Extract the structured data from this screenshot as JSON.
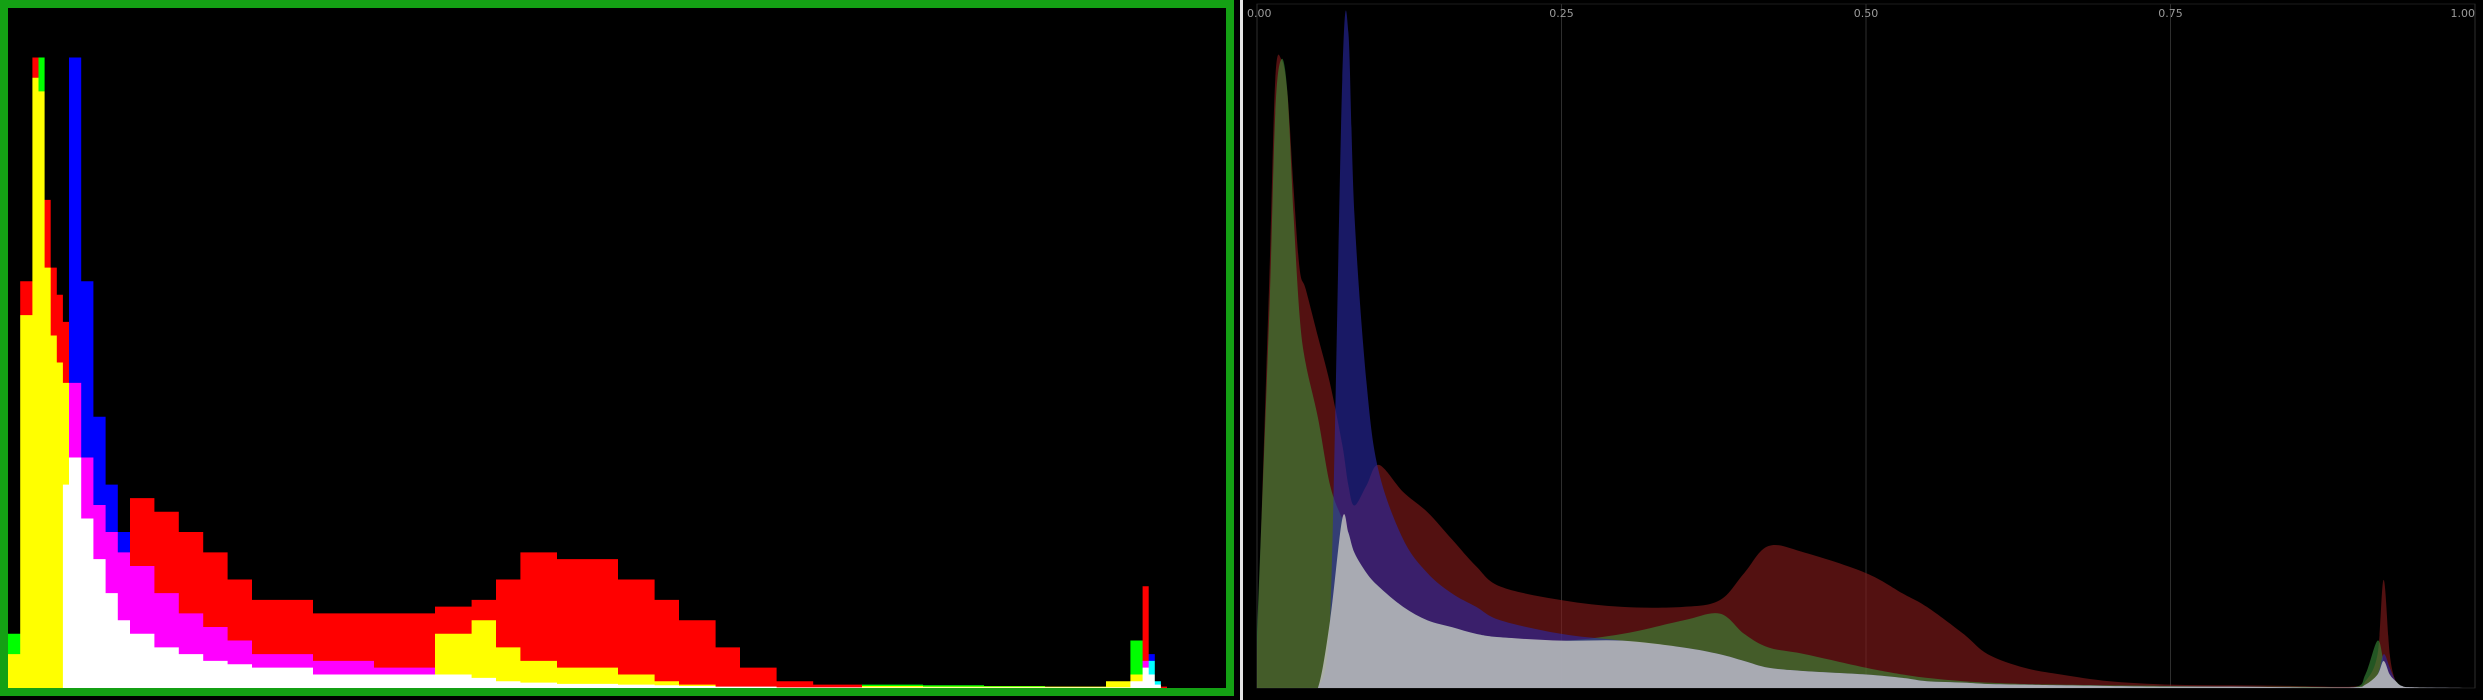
{
  "chart_data": [
    {
      "type": "area",
      "style": "step",
      "blend": "additive-primary",
      "frame_color": "#14a014",
      "x": [
        0.0,
        0.01,
        0.02,
        0.025,
        0.03,
        0.035,
        0.04,
        0.045,
        0.05,
        0.06,
        0.07,
        0.08,
        0.09,
        0.1,
        0.12,
        0.14,
        0.16,
        0.18,
        0.2,
        0.25,
        0.3,
        0.35,
        0.38,
        0.4,
        0.42,
        0.45,
        0.5,
        0.53,
        0.55,
        0.58,
        0.6,
        0.63,
        0.66,
        0.7,
        0.75,
        0.8,
        0.85,
        0.9,
        0.92,
        0.93,
        0.935,
        0.94,
        0.945,
        0.95,
        0.96,
        1.0
      ],
      "series": [
        {
          "color": "#ff0000",
          "values": [
            0.05,
            0.6,
            0.93,
            0.88,
            0.72,
            0.62,
            0.58,
            0.54,
            0.45,
            0.34,
            0.27,
            0.23,
            0.2,
            0.28,
            0.26,
            0.23,
            0.2,
            0.16,
            0.13,
            0.11,
            0.11,
            0.12,
            0.13,
            0.16,
            0.2,
            0.19,
            0.16,
            0.13,
            0.1,
            0.06,
            0.03,
            0.01,
            0.005,
            0.003,
            0.002,
            0.002,
            0.002,
            0.01,
            0.02,
            0.15,
            0.02,
            0.005,
            0.002,
            0.0,
            0.0,
            0.0
          ]
        },
        {
          "color": "#00ff00",
          "values": [
            0.08,
            0.55,
            0.9,
            0.93,
            0.62,
            0.52,
            0.48,
            0.45,
            0.34,
            0.25,
            0.19,
            0.14,
            0.1,
            0.08,
            0.06,
            0.05,
            0.04,
            0.035,
            0.03,
            0.02,
            0.02,
            0.08,
            0.1,
            0.06,
            0.04,
            0.03,
            0.02,
            0.01,
            0.005,
            0.002,
            0.002,
            0.001,
            0.001,
            0.005,
            0.004,
            0.003,
            0.002,
            0.01,
            0.07,
            0.03,
            0.04,
            0.01,
            0.0,
            0.0,
            0.0,
            0.0
          ]
        },
        {
          "color": "#0000ff",
          "values": [
            0.0,
            0.0,
            0.0,
            0.0,
            0.0,
            0.0,
            0.0,
            0.3,
            0.93,
            0.6,
            0.4,
            0.3,
            0.23,
            0.18,
            0.14,
            0.11,
            0.09,
            0.07,
            0.05,
            0.04,
            0.03,
            0.02,
            0.015,
            0.01,
            0.008,
            0.006,
            0.005,
            0.004,
            0.003,
            0.002,
            0.002,
            0.001,
            0.001,
            0.001,
            0.001,
            0.001,
            0.001,
            0.001,
            0.01,
            0.04,
            0.05,
            0.01,
            0.0,
            0.0,
            0.0,
            0.0
          ]
        }
      ]
    },
    {
      "type": "area",
      "style": "smooth",
      "blend": "translucent",
      "xlim": [
        0,
        1
      ],
      "xticks": [
        "0.00",
        "0.25",
        "0.50",
        "0.75",
        "1.00"
      ],
      "grid": true,
      "x": [
        0.0,
        0.01,
        0.015,
        0.02,
        0.025,
        0.03,
        0.035,
        0.04,
        0.05,
        0.06,
        0.07,
        0.075,
        0.08,
        0.09,
        0.1,
        0.12,
        0.14,
        0.16,
        0.18,
        0.2,
        0.25,
        0.3,
        0.35,
        0.38,
        0.4,
        0.42,
        0.45,
        0.5,
        0.53,
        0.55,
        0.58,
        0.6,
        0.63,
        0.66,
        0.7,
        0.75,
        0.8,
        0.85,
        0.9,
        0.91,
        0.92,
        0.925,
        0.93,
        0.935,
        0.94,
        0.95,
        1.0
      ],
      "series": [
        {
          "color": "#8a1c1c",
          "values": [
            0.05,
            0.6,
            0.9,
            0.93,
            0.88,
            0.74,
            0.62,
            0.59,
            0.52,
            0.45,
            0.36,
            0.3,
            0.27,
            0.3,
            0.33,
            0.29,
            0.26,
            0.22,
            0.18,
            0.15,
            0.13,
            0.12,
            0.12,
            0.13,
            0.17,
            0.21,
            0.2,
            0.17,
            0.14,
            0.12,
            0.08,
            0.05,
            0.03,
            0.02,
            0.01,
            0.005,
            0.004,
            0.003,
            0.002,
            0.01,
            0.05,
            0.16,
            0.05,
            0.01,
            0.003,
            0.001,
            0.0
          ]
        },
        {
          "color": "#3a8f3a",
          "values": [
            0.08,
            0.55,
            0.85,
            0.93,
            0.88,
            0.7,
            0.55,
            0.48,
            0.4,
            0.3,
            0.25,
            0.23,
            0.2,
            0.17,
            0.15,
            0.12,
            0.1,
            0.09,
            0.08,
            0.075,
            0.07,
            0.08,
            0.1,
            0.11,
            0.08,
            0.06,
            0.05,
            0.03,
            0.02,
            0.015,
            0.01,
            0.008,
            0.006,
            0.005,
            0.004,
            0.003,
            0.002,
            0.002,
            0.001,
            0.02,
            0.07,
            0.04,
            0.02,
            0.01,
            0.003,
            0.001,
            0.0
          ]
        },
        {
          "color": "#2a2aa8",
          "values": [
            0.0,
            0.0,
            0.0,
            0.0,
            0.0,
            0.0,
            0.0,
            0.0,
            0.0,
            0.1,
            0.9,
            0.97,
            0.7,
            0.45,
            0.32,
            0.22,
            0.17,
            0.14,
            0.12,
            0.1,
            0.08,
            0.07,
            0.06,
            0.05,
            0.04,
            0.03,
            0.025,
            0.02,
            0.015,
            0.01,
            0.008,
            0.006,
            0.005,
            0.004,
            0.003,
            0.002,
            0.002,
            0.001,
            0.001,
            0.005,
            0.02,
            0.05,
            0.03,
            0.01,
            0.003,
            0.001,
            0.0
          ]
        }
      ]
    }
  ]
}
